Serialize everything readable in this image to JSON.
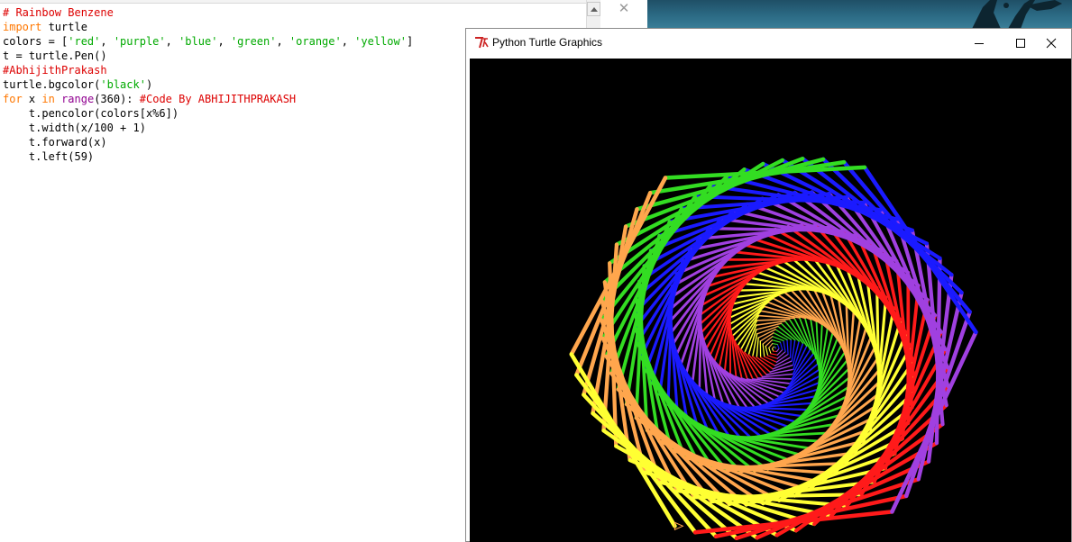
{
  "editor": {
    "lines": [
      [
        {
          "t": "# Rainbow Benzene",
          "c": "comment"
        }
      ],
      [
        {
          "t": "import",
          "c": "keyword"
        },
        {
          "t": " turtle",
          "c": "plain"
        }
      ],
      [
        {
          "t": "colors = [",
          "c": "plain"
        },
        {
          "t": "'red'",
          "c": "string"
        },
        {
          "t": ", ",
          "c": "plain"
        },
        {
          "t": "'purple'",
          "c": "string"
        },
        {
          "t": ", ",
          "c": "plain"
        },
        {
          "t": "'blue'",
          "c": "string"
        },
        {
          "t": ", ",
          "c": "plain"
        },
        {
          "t": "'green'",
          "c": "string"
        },
        {
          "t": ", ",
          "c": "plain"
        },
        {
          "t": "'orange'",
          "c": "string"
        },
        {
          "t": ", ",
          "c": "plain"
        },
        {
          "t": "'yellow'",
          "c": "string"
        },
        {
          "t": "]",
          "c": "plain"
        }
      ],
      [
        {
          "t": "t = turtle.Pen()",
          "c": "plain"
        }
      ],
      [
        {
          "t": "#AbhijithPrakash",
          "c": "comment"
        }
      ],
      [
        {
          "t": "turtle.bgcolor(",
          "c": "plain"
        },
        {
          "t": "'black'",
          "c": "string"
        },
        {
          "t": ")",
          "c": "plain"
        }
      ],
      [
        {
          "t": "for",
          "c": "keyword"
        },
        {
          "t": " x ",
          "c": "plain"
        },
        {
          "t": "in",
          "c": "keyword"
        },
        {
          "t": " ",
          "c": "plain"
        },
        {
          "t": "range",
          "c": "builtin"
        },
        {
          "t": "(360): ",
          "c": "plain"
        },
        {
          "t": "#Code By ABHIJITHPRAKASH",
          "c": "comment"
        }
      ],
      [
        {
          "t": "    t.pencolor(colors[x%6])",
          "c": "plain"
        }
      ],
      [
        {
          "t": "    t.width(x/100 + 1)",
          "c": "plain"
        }
      ],
      [
        {
          "t": "    t.forward(x)",
          "c": "plain"
        }
      ],
      [
        {
          "t": "    t.left(59)",
          "c": "plain"
        }
      ]
    ]
  },
  "syntax_colors": {
    "comment": "#dd0000",
    "keyword": "#ff7700",
    "builtin": "#900090",
    "string": "#00aa00",
    "plain": "#000000"
  },
  "turtle_window": {
    "title": "Python Turtle Graphics",
    "icon": "tk-feather-icon",
    "controls": [
      "minimize-icon",
      "maximize-icon",
      "close-icon"
    ],
    "background": "#000000",
    "pen_colors": [
      "red",
      "purple",
      "blue",
      "green",
      "orange",
      "yellow"
    ],
    "steps": 360,
    "turn_degrees": 59
  },
  "background_window": {
    "control": "close-icon"
  }
}
